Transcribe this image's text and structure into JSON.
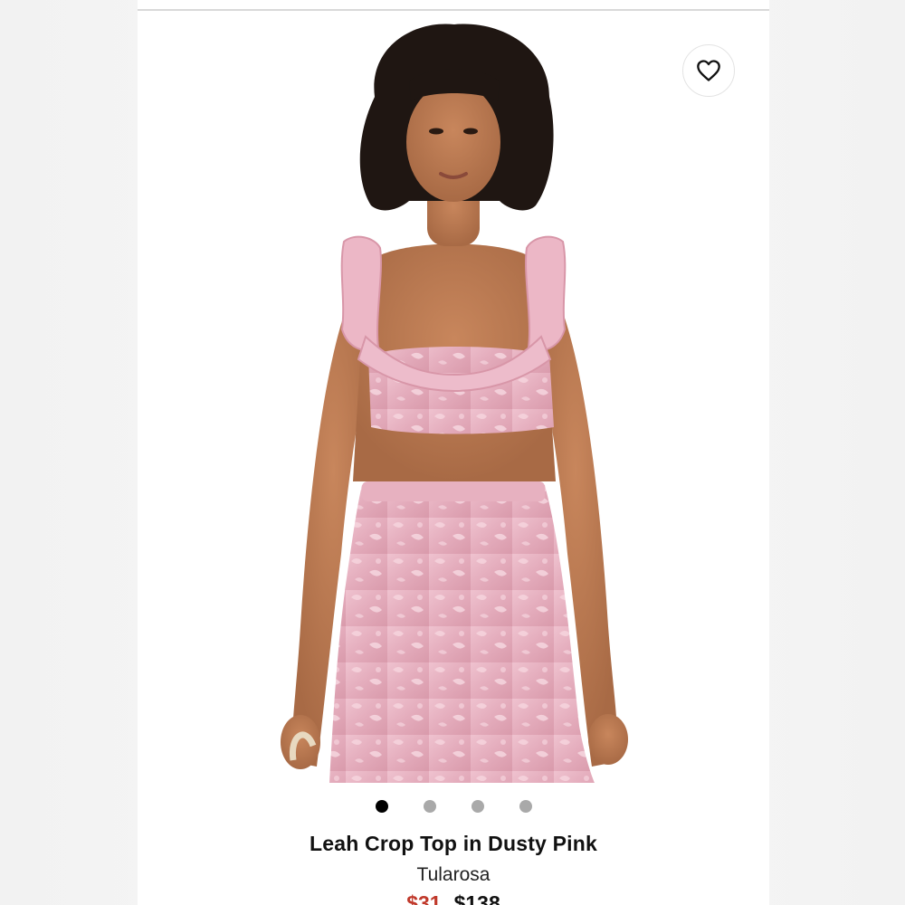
{
  "product": {
    "title": "Leah Crop Top in Dusty Pink",
    "brand": "Tularosa",
    "sale_price": "$31",
    "original_price": "$138"
  },
  "gallery": {
    "image_count": 4,
    "active_index": 0
  },
  "icons": {
    "favorite": "heart-icon"
  },
  "colors": {
    "garment": "#e8b4c2",
    "sale_price": "#c0392b"
  }
}
